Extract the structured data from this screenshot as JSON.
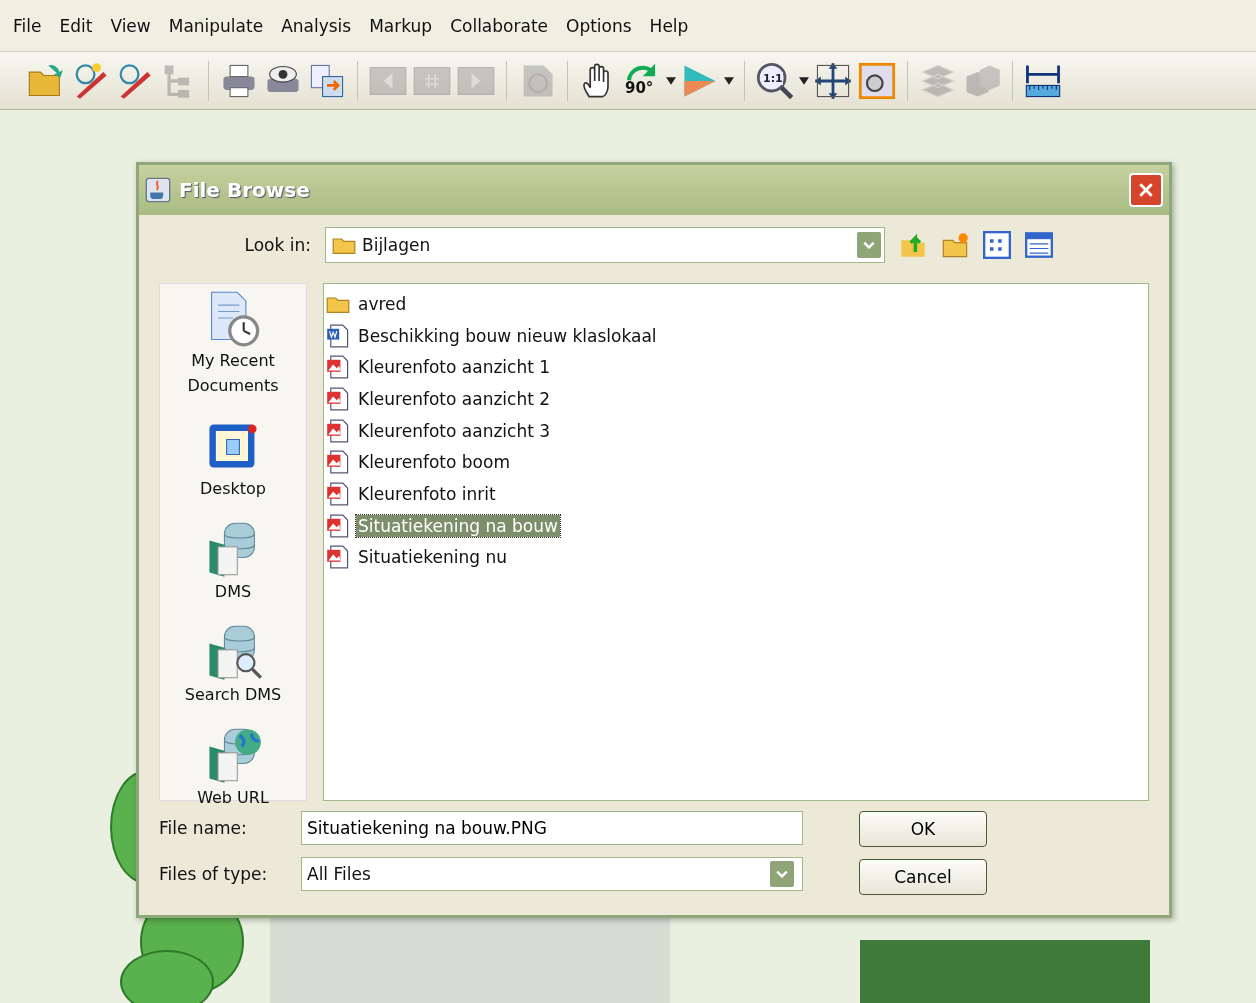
{
  "menu": [
    "File",
    "Edit",
    "View",
    "Manipulate",
    "Analysis",
    "Markup",
    "Collaborate",
    "Options",
    "Help"
  ],
  "toolbar": [
    {
      "kind": "open",
      "disabled": false
    },
    {
      "kind": "markup-new",
      "disabled": false
    },
    {
      "kind": "markup-edit",
      "disabled": false
    },
    {
      "kind": "tree",
      "disabled": true
    },
    {
      "kind": "sep"
    },
    {
      "kind": "print",
      "disabled": false
    },
    {
      "kind": "preview",
      "disabled": false
    },
    {
      "kind": "export",
      "disabled": false
    },
    {
      "kind": "sep"
    },
    {
      "kind": "page-prev",
      "disabled": true
    },
    {
      "kind": "page-num",
      "disabled": true
    },
    {
      "kind": "page-next",
      "disabled": true
    },
    {
      "kind": "sep"
    },
    {
      "kind": "shape",
      "disabled": true
    },
    {
      "kind": "sep"
    },
    {
      "kind": "hand",
      "disabled": false
    },
    {
      "kind": "rotate",
      "label": "90°",
      "disabled": false
    },
    {
      "kind": "caret"
    },
    {
      "kind": "flip",
      "disabled": false
    },
    {
      "kind": "caret"
    },
    {
      "kind": "sep"
    },
    {
      "kind": "zoom",
      "label": "1:1",
      "disabled": false
    },
    {
      "kind": "caret"
    },
    {
      "kind": "fit",
      "disabled": false
    },
    {
      "kind": "zoom-window",
      "disabled": false
    },
    {
      "kind": "sep"
    },
    {
      "kind": "layers",
      "disabled": true
    },
    {
      "kind": "blocks",
      "disabled": true
    },
    {
      "kind": "sep"
    },
    {
      "kind": "measure",
      "disabled": false
    }
  ],
  "dialog": {
    "title": "File Browse",
    "look_in": {
      "label": "Look in:",
      "value": "Bijlagen"
    },
    "places": [
      {
        "kind": "recent",
        "label": "My Recent Documents"
      },
      {
        "kind": "desktop",
        "label": "Desktop"
      },
      {
        "kind": "dms",
        "label": "DMS"
      },
      {
        "kind": "search",
        "label": "Search DMS"
      },
      {
        "kind": "web",
        "label": "Web URL"
      }
    ],
    "files": [
      {
        "kind": "folder",
        "name": "avred",
        "selected": false
      },
      {
        "kind": "document",
        "name": "Beschikking bouw nieuw klaslokaal",
        "selected": false
      },
      {
        "kind": "image",
        "name": "Kleurenfoto aanzicht 1",
        "selected": false
      },
      {
        "kind": "image",
        "name": "Kleurenfoto aanzicht 2",
        "selected": false
      },
      {
        "kind": "image",
        "name": "Kleurenfoto aanzicht 3",
        "selected": false
      },
      {
        "kind": "image",
        "name": "Kleurenfoto boom",
        "selected": false
      },
      {
        "kind": "image",
        "name": "Kleurenfoto inrit",
        "selected": false
      },
      {
        "kind": "image",
        "name": "Situatiekening na bouw",
        "selected": true
      },
      {
        "kind": "image",
        "name": "Situatiekening nu",
        "selected": false
      }
    ],
    "file_name": {
      "label": "File name:",
      "value": "Situatiekening na bouw.PNG"
    },
    "file_type": {
      "label": "Files of type:",
      "value": "All Files"
    },
    "buttons": [
      "OK",
      "Cancel"
    ]
  }
}
